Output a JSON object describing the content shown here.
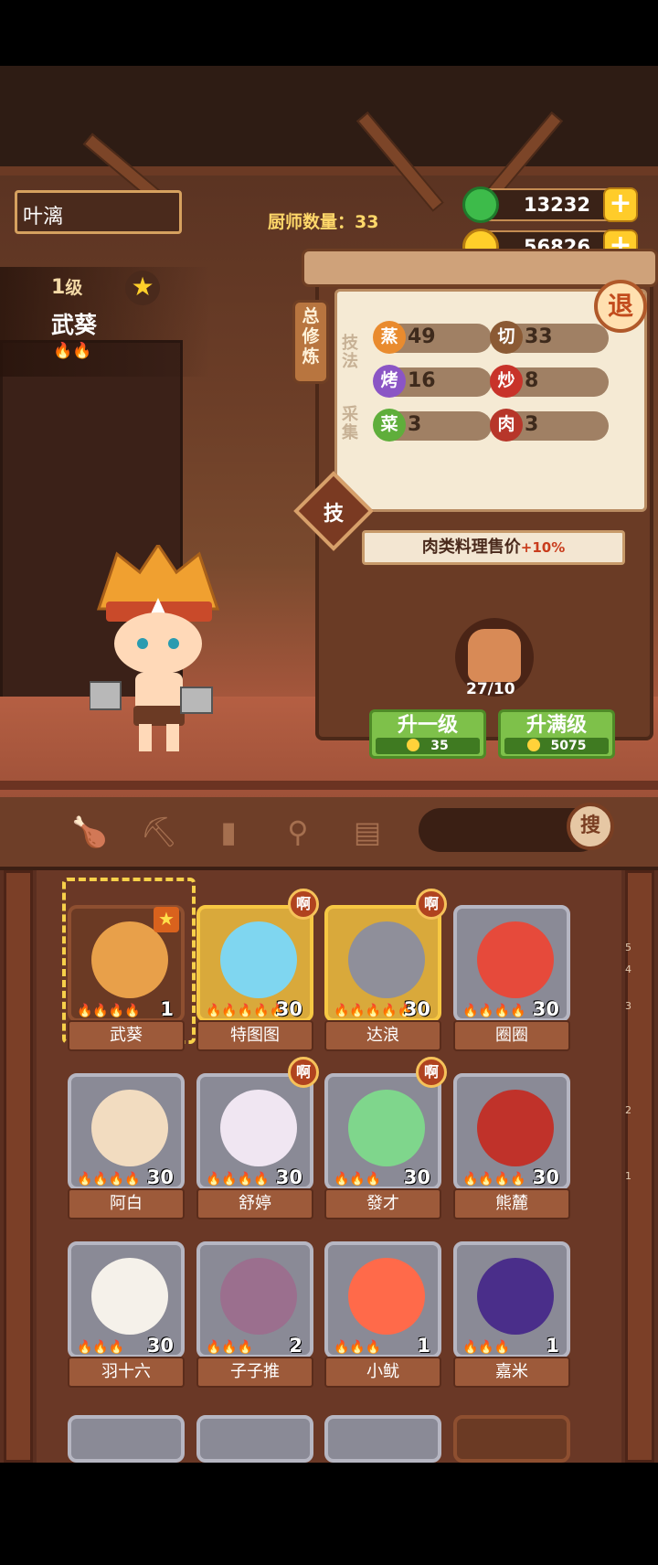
{
  "top": {
    "player_name": "叶漓",
    "chef_count_label": "厨师数量：",
    "chef_count": "33",
    "jade": "13232",
    "coins": "56826",
    "plus": "+"
  },
  "character": {
    "level_num": "1",
    "level_suffix": "级",
    "name": "武葵",
    "flames": "🔥🔥"
  },
  "panel": {
    "tab": "总修炼",
    "exit": "退",
    "cat_technique": "技法",
    "cat_gather": "采集",
    "stats": [
      {
        "icon": "蒸",
        "value": "49",
        "color": "#e98b2e"
      },
      {
        "icon": "切",
        "value": "33",
        "color": "#8b5a34"
      },
      {
        "icon": "烤",
        "value": "16",
        "color": "#8b55c5"
      },
      {
        "icon": "炒",
        "value": "8",
        "color": "#c8332a"
      },
      {
        "icon": "菜",
        "value": "3",
        "color": "#5fae3b"
      },
      {
        "icon": "肉",
        "value": "3",
        "color": "#b7362a"
      }
    ],
    "skill": "技",
    "bonus_text": "肉类料理售价",
    "bonus_value": "+10%",
    "medal_count": "27/10",
    "upgrade_one": "升一级",
    "upgrade_one_cost": "35",
    "upgrade_max": "升满级",
    "upgrade_max_cost": "5075"
  },
  "toolbar": {
    "search_button": "搜"
  },
  "roster": [
    {
      "name": "武葵",
      "level": "1",
      "flames": "🔥🔥🔥🔥",
      "frame": "brown",
      "color": "#e8a04a",
      "badge": "",
      "star": "★"
    },
    {
      "name": "特图图",
      "level": "30",
      "flames": "🔥🔥🔥🔥🔥",
      "frame": "gold",
      "color": "#7fd6f0",
      "badge": "啊",
      "star": ""
    },
    {
      "name": "达浪",
      "level": "30",
      "flames": "🔥🔥🔥🔥🔥",
      "frame": "gold",
      "color": "#8f8f9a",
      "badge": "啊",
      "star": ""
    },
    {
      "name": "圈圈",
      "level": "30",
      "flames": "🔥🔥🔥🔥",
      "frame": "silver",
      "color": "#e64a3b",
      "badge": "",
      "star": ""
    },
    {
      "name": "阿白",
      "level": "30",
      "flames": "🔥🔥🔥🔥",
      "frame": "silver",
      "color": "#f2dcc0",
      "badge": "",
      "star": ""
    },
    {
      "name": "舒婷",
      "level": "30",
      "flames": "🔥🔥🔥🔥",
      "frame": "silver",
      "color": "#f0e6f2",
      "badge": "啊",
      "star": ""
    },
    {
      "name": "發才",
      "level": "30",
      "flames": "🔥🔥🔥",
      "frame": "silver",
      "color": "#7fd68c",
      "badge": "啊",
      "star": ""
    },
    {
      "name": "熊麓",
      "level": "30",
      "flames": "🔥🔥🔥🔥",
      "frame": "silver",
      "color": "#c0322a",
      "badge": "",
      "star": ""
    },
    {
      "name": "羽十六",
      "level": "30",
      "flames": "🔥🔥🔥",
      "frame": "silver",
      "color": "#f5f1ea",
      "badge": "",
      "star": ""
    },
    {
      "name": "子子推",
      "level": "2",
      "flames": "🔥🔥🔥",
      "frame": "silver",
      "color": "#9b6f8e",
      "badge": "",
      "star": ""
    },
    {
      "name": "小鱿",
      "level": "1",
      "flames": "🔥🔥🔥",
      "frame": "silver",
      "color": "#ff6a4a",
      "badge": "",
      "star": ""
    },
    {
      "name": "嘉米",
      "level": "1",
      "flames": "🔥🔥🔥",
      "frame": "silver",
      "color": "#4a2e8a",
      "badge": "",
      "star": ""
    }
  ],
  "scale_ticks": [
    "5",
    "4",
    "3",
    "2",
    "1"
  ]
}
